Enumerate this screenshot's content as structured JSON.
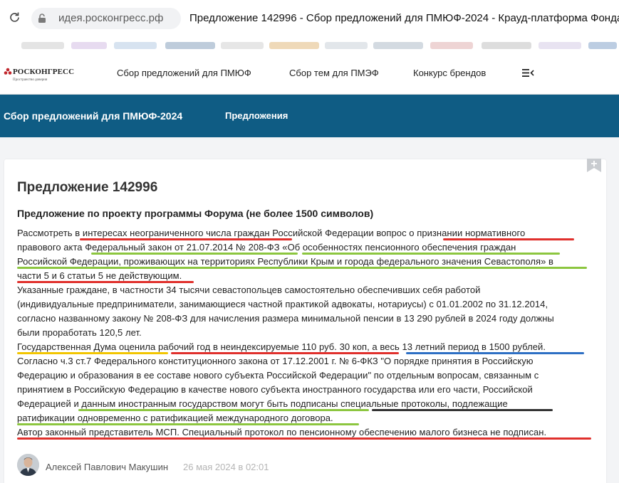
{
  "browser": {
    "url": "идея.росконгресс.рф",
    "tab_title": "Предложение 142996 - Сбор предложений для ПМЮФ-2024 - Крауд-платформа Фонда Росконгресс"
  },
  "header": {
    "logo_text": "РОСКОНГРЕСС",
    "logo_subtitle": "Пространство доверия",
    "nav": [
      "Сбор предложений для ПМЮФ",
      "Сбор тем для ПМЭФ",
      "Конкурс брендов"
    ],
    "menu_icon": "collapse-menu-icon"
  },
  "subheader": {
    "title": "Сбор предложений для ПМЮФ-2024",
    "tab": "Предложения"
  },
  "proposal": {
    "title": "Предложение 142996",
    "section_title": "Предложение по проекту программы Форума (не более 1500 символов)",
    "lines": [
      "Рассмотреть в интересах неограниченного числа граждан Российской Федерации вопрос о признании нормативного",
      "правового акта Федеральный закон от 21.07.2014 № 208-ФЗ «Об особенностях пенсионного обеспечения граждан",
      "Российской Федерации, проживающих на территориях Республики Крым и города федерального значения Севастополя» в",
      "части 5 и 6 статьи 5 не действующим.",
      "Указанные граждане, в частности 34 тысячи севастопольцев самостоятельно обеспечивших себя работой",
      "(индивидуальные предприниматели, занимающиеся частной практикой адвокаты, нотариусы) с 01.01.2002 по 31.12.2014,",
      "согласно названному закону № 208-ФЗ для начисления размера минимальной пенсии в 13 290 рублей в 2024 году должны",
      "были проработать 120,5 лет.",
      "Государственная Дума оценила рабочий год в неиндексируемые 110 руб. 30 коп, а весь 13 летний период в 1500 рублей.",
      "Согласно ч.3 ст.7 Федерального конституционного закона от 17.12.2001 г. № 6-ФКЗ \"О порядке принятия в Российскую",
      "Федерацию и образования в ее составе нового субъекта Российской Федерации\" по отдельным вопросам, связанным с",
      "принятием в Российскую Федерацию в качестве нового субъекта иностранного государства или его части, Российской",
      "Федерацией и данным иностранным государством могут быть подписаны специальные протоколы, подлежащие",
      "ратификации одновременно с ратификацией международного договора.",
      "Автор законный представитель МСП. Специальный протокол по пенсионному обеспечению малого бизнеса не подписан."
    ]
  },
  "author": {
    "name": "Алексей Павлович Макушин",
    "date": "26 мая 2024 в 02:01"
  },
  "colors": {
    "brand_blue": "#0f5c84",
    "underline_red": "#e0302c",
    "underline_green": "#8cc63f",
    "underline_yellow": "#f2c500",
    "underline_blue": "#2d6fc4",
    "underline_dark": "#333333"
  }
}
